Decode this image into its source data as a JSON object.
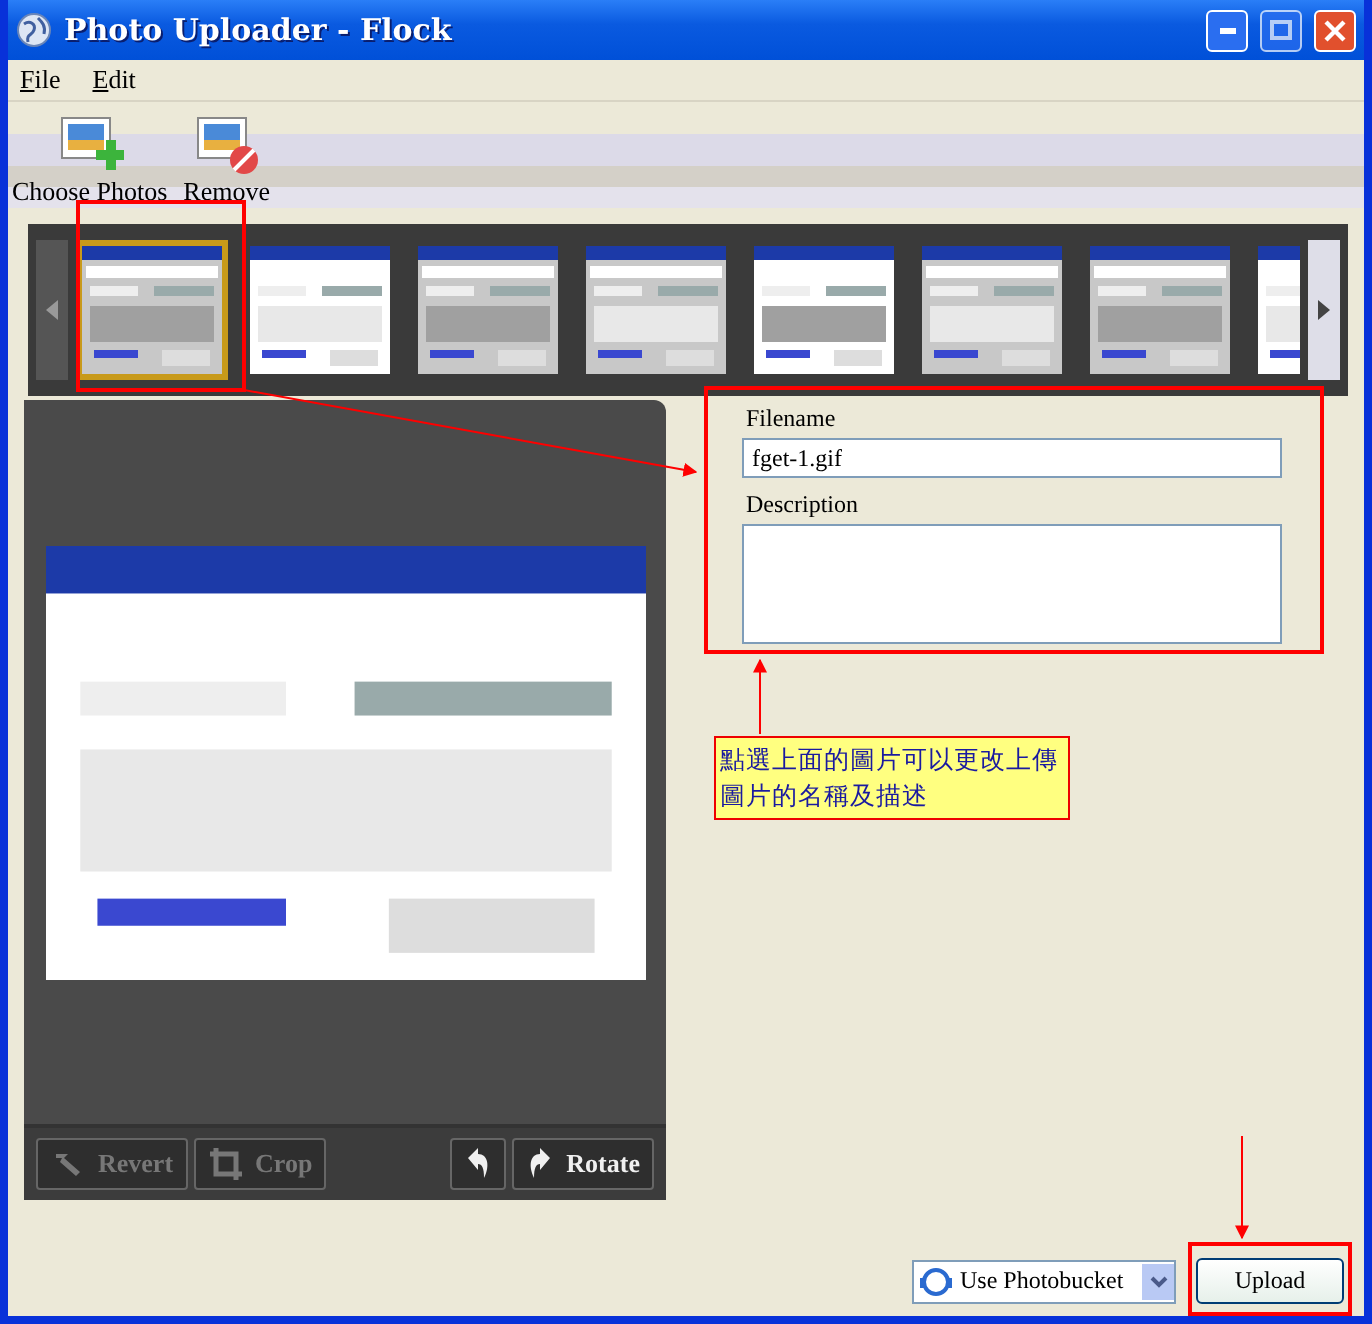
{
  "window": {
    "title": "Photo Uploader - Flock"
  },
  "menu": [
    {
      "label": "File"
    },
    {
      "label": "Edit"
    }
  ],
  "toolbar": [
    {
      "label": "Choose Photos",
      "kind": "add"
    },
    {
      "label": "Remove",
      "kind": "remove"
    }
  ],
  "thumbnails": [
    {
      "kind": "picture",
      "selected": true
    },
    {
      "kind": "picture",
      "selected": false
    },
    {
      "kind": "picture",
      "selected": false
    },
    {
      "kind": "picture",
      "selected": false
    },
    {
      "kind": "picture",
      "selected": false
    },
    {
      "kind": "picture",
      "selected": false
    },
    {
      "kind": "picture",
      "selected": false
    },
    {
      "kind": "picture",
      "selected": false
    }
  ],
  "preview": {
    "kind": "picture"
  },
  "editor_buttons": [
    {
      "kind": "revert",
      "label": "Revert",
      "disabled": true
    },
    {
      "kind": "crop",
      "label": "Crop",
      "disabled": true
    },
    {
      "kind": "rotate-left",
      "disabled": false
    },
    {
      "kind": "rotate-right",
      "label": "Rotate",
      "disabled": false
    }
  ],
  "form": {
    "filename_label": "Filename",
    "filename": "fget-1.gif",
    "description_label": "Description"
  },
  "annotation": {
    "note": "點選上面的圖片可以更改上傳圖片的名稱及描述"
  },
  "service": {
    "value": "Use Photobucket"
  },
  "upload_button": {
    "label": "Upload"
  }
}
